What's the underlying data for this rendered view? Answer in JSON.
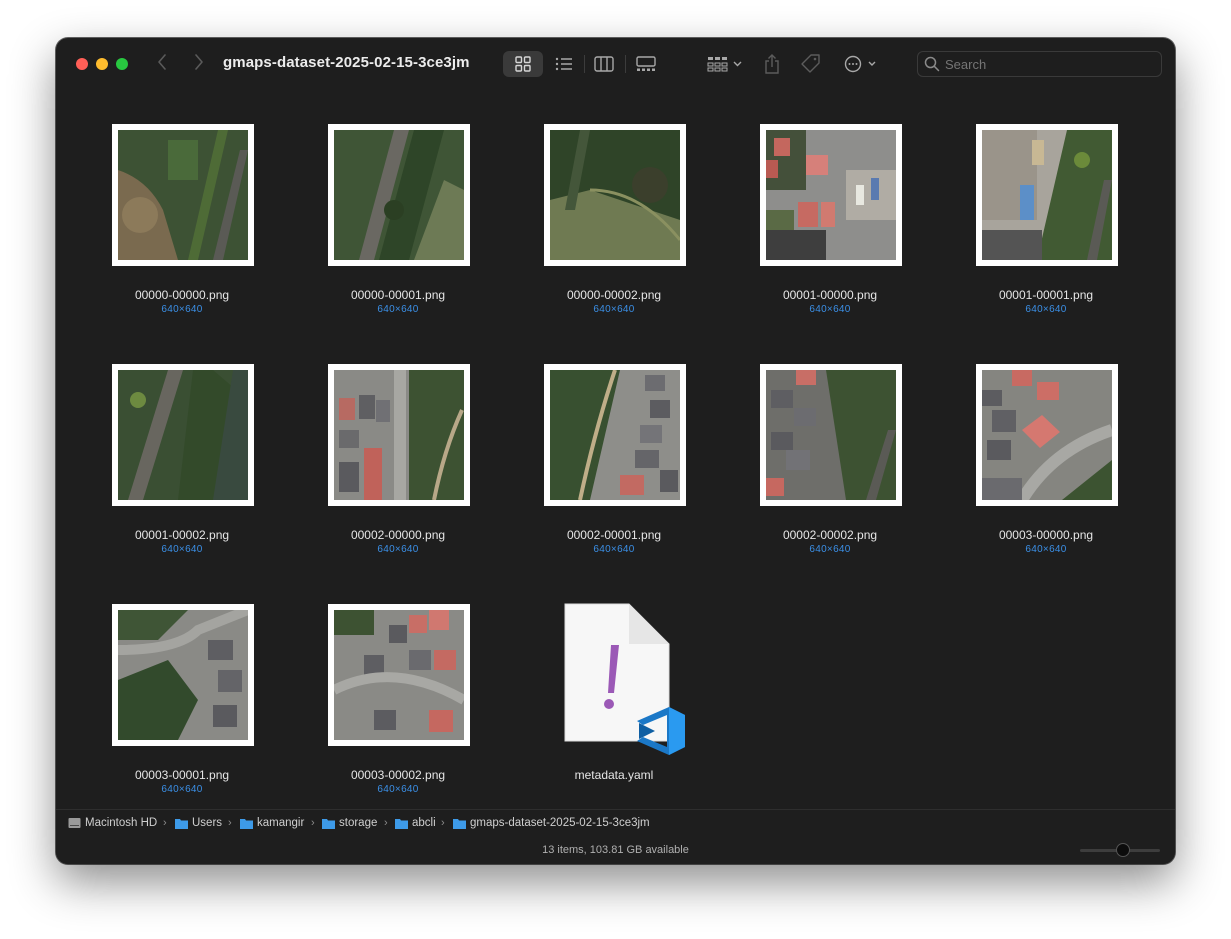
{
  "window": {
    "title": "gmaps-dataset-2025-02-15-3ce3jm"
  },
  "toolbar": {
    "back_icon": "chevron-left-icon",
    "forward_icon": "chevron-right-icon",
    "view_modes": [
      "icon-view",
      "list-view",
      "column-view",
      "gallery-view"
    ],
    "active_view": "icon-view",
    "search_placeholder": "Search"
  },
  "files": [
    {
      "name": "00000-00000.png",
      "dims": "640×640"
    },
    {
      "name": "00000-00001.png",
      "dims": "640×640"
    },
    {
      "name": "00000-00002.png",
      "dims": "640×640"
    },
    {
      "name": "00001-00000.png",
      "dims": "640×640"
    },
    {
      "name": "00001-00001.png",
      "dims": "640×640"
    },
    {
      "name": "00001-00002.png",
      "dims": "640×640"
    },
    {
      "name": "00002-00000.png",
      "dims": "640×640"
    },
    {
      "name": "00002-00001.png",
      "dims": "640×640"
    },
    {
      "name": "00002-00002.png",
      "dims": "640×640"
    },
    {
      "name": "00003-00000.png",
      "dims": "640×640"
    },
    {
      "name": "00003-00001.png",
      "dims": "640×640"
    },
    {
      "name": "00003-00002.png",
      "dims": "640×640"
    },
    {
      "name": "metadata.yaml",
      "dims": ""
    }
  ],
  "pathbar": {
    "items": [
      "Macintosh HD",
      "Users",
      "kamangir",
      "storage",
      "abcli",
      "gmaps-dataset-2025-02-15-3ce3jm"
    ]
  },
  "status": {
    "text": "13 items, 103.81 GB available"
  },
  "colors": {
    "window_bg": "#1e1e1e",
    "accent_blue": "#3b8fe6",
    "close": "#ff5f57",
    "minimize": "#febc2e",
    "maximize": "#28c840"
  }
}
